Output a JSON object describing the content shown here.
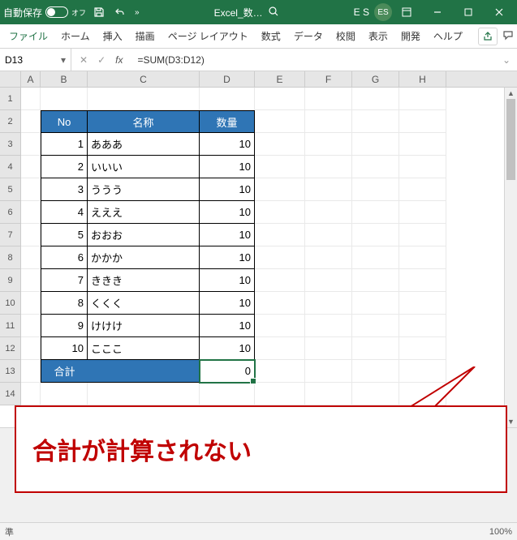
{
  "titlebar": {
    "autosave_label": "自動保存",
    "autosave_state": "オフ",
    "filename": "Excel_数…",
    "user_initials": "E S",
    "avatar": "ES"
  },
  "ribbon": {
    "tabs": [
      "ファイル",
      "ホーム",
      "挿入",
      "描画",
      "ページ レイアウト",
      "数式",
      "データ",
      "校閲",
      "表示",
      "開発",
      "ヘルプ"
    ]
  },
  "namebox": {
    "cell": "D13"
  },
  "formula": {
    "value": "=SUM(D3:D12)"
  },
  "columns": [
    "A",
    "B",
    "C",
    "D",
    "E",
    "F",
    "G",
    "H"
  ],
  "table": {
    "headers": {
      "no": "No",
      "name": "名称",
      "qty": "数量"
    },
    "rows": [
      {
        "no": "1",
        "name": "あああ",
        "qty": "10"
      },
      {
        "no": "2",
        "name": "いいい",
        "qty": "10"
      },
      {
        "no": "3",
        "name": "ううう",
        "qty": "10"
      },
      {
        "no": "4",
        "name": "えええ",
        "qty": "10"
      },
      {
        "no": "5",
        "name": "おおお",
        "qty": "10"
      },
      {
        "no": "6",
        "name": "かかか",
        "qty": "10"
      },
      {
        "no": "7",
        "name": "ききき",
        "qty": "10"
      },
      {
        "no": "8",
        "name": "くくく",
        "qty": "10"
      },
      {
        "no": "9",
        "name": "けけけ",
        "qty": "10"
      },
      {
        "no": "10",
        "name": "こここ",
        "qty": "10"
      }
    ],
    "total_label": "合計",
    "total_value": "0"
  },
  "callout": {
    "text": "合計が計算されない"
  },
  "status": {
    "left": "準",
    "zoom": "100%"
  },
  "row_numbers": [
    "1",
    "2",
    "3",
    "4",
    "5",
    "6",
    "7",
    "8",
    "9",
    "10",
    "11",
    "12",
    "13",
    "14"
  ]
}
